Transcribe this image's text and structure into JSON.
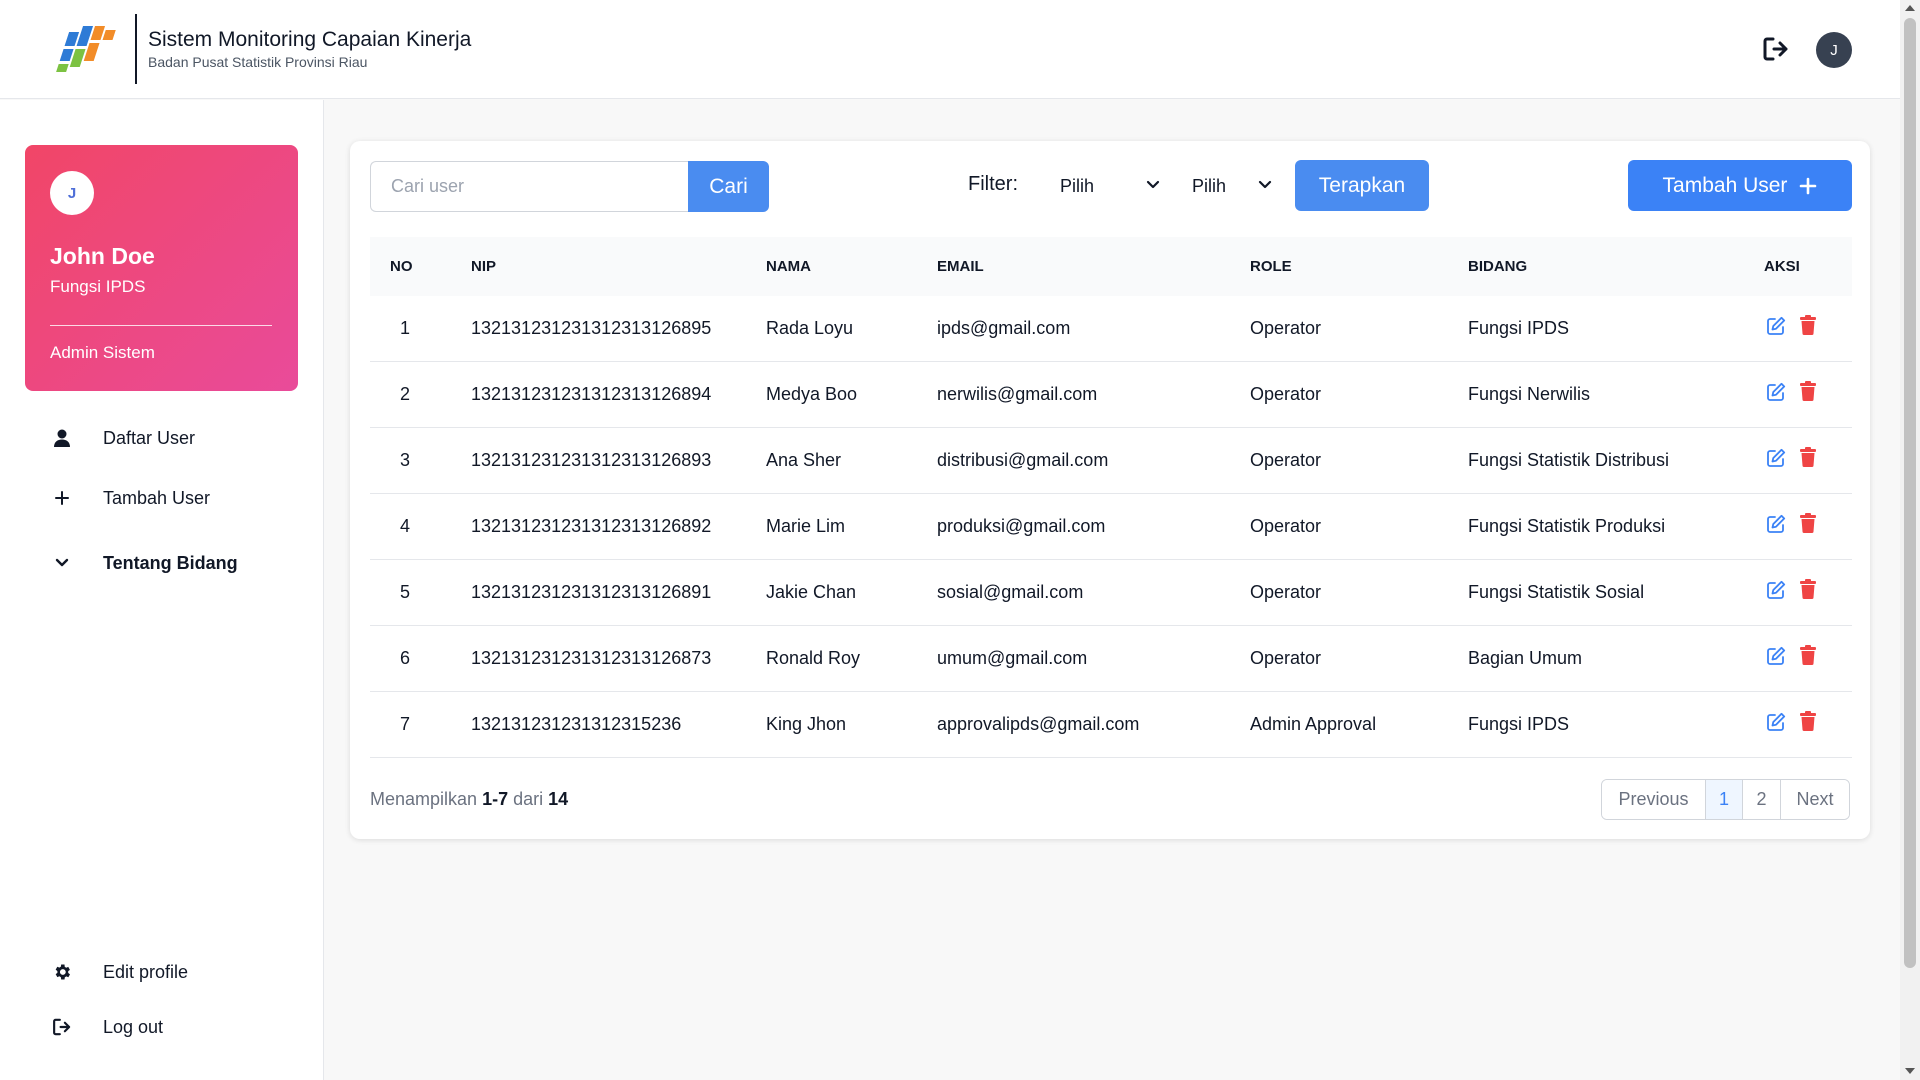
{
  "header": {
    "title": "Sistem Monitoring Capaian Kinerja",
    "subtitle": "Badan Pusat Statistik Provinsi Riau",
    "avatar_initial": "J"
  },
  "sidebar": {
    "profile": {
      "avatar_initial": "J",
      "name": "John Doe",
      "department": "Fungsi IPDS",
      "role": "Admin Sistem"
    },
    "nav": [
      {
        "label": "Daftar User",
        "icon": "user-icon"
      },
      {
        "label": "Tambah User",
        "icon": "plus-icon"
      },
      {
        "label": "Tentang Bidang",
        "icon": "chevron-down-icon"
      }
    ],
    "bottom": [
      {
        "label": "Edit profile",
        "icon": "gear-icon"
      },
      {
        "label": "Log out",
        "icon": "logout-icon"
      }
    ]
  },
  "toolbar": {
    "search_placeholder": "Cari user",
    "search_label": "Cari",
    "filter_label": "Filter:",
    "filter1_value": "Pilih",
    "filter2_value": "Pilih",
    "apply_label": "Terapkan",
    "add_label": "Tambah User"
  },
  "table": {
    "headers": {
      "no": "NO",
      "nip": "NIP",
      "nama": "NAMA",
      "email": "EMAIL",
      "role": "ROLE",
      "bidang": "BIDANG",
      "aksi": "AKSI"
    },
    "rows": [
      {
        "no": "1",
        "nip": "13213123123131231312689‌5",
        "nama": "Rada Loyu",
        "email": "ipds@gmail.com",
        "role": "Operator",
        "bidang": "Fungsi IPDS"
      },
      {
        "no": "2",
        "nip": "132131231231312313126894",
        "nama": "Medya Boo",
        "email": "nerwilis@gmail.com",
        "role": "Operator",
        "bidang": "Fungsi Nerwilis"
      },
      {
        "no": "3",
        "nip": "132131231231312313126893",
        "nama": "Ana Sher",
        "email": "distribusi@gmail.com",
        "role": "Operator",
        "bidang": "Fungsi Statistik Distribusi"
      },
      {
        "no": "4",
        "nip": "132131231231312313126892",
        "nama": "Marie Lim",
        "email": "produksi@gmail.com",
        "role": "Operator",
        "bidang": "Fungsi Statistik Produksi"
      },
      {
        "no": "5",
        "nip": "132131231231312313126891",
        "nama": "Jakie Chan",
        "email": "sosial@gmail.com",
        "role": "Operator",
        "bidang": "Fungsi Statistik Sosial"
      },
      {
        "no": "6",
        "nip": "132131231231312313126873",
        "nama": "Ronald Roy",
        "email": "umum@gmail.com",
        "role": "Operator",
        "bidang": "Bagian Umum"
      },
      {
        "no": "7",
        "nip": "13213123123131231523‌6",
        "nama": "King Jhon",
        "email": "approvalipds@gmail.com",
        "role": "Admin Approval",
        "bidang": "Fungsi IPDS"
      }
    ]
  },
  "footer": {
    "showing_prefix": "Menampilkan",
    "showing_range": "1-7",
    "showing_mid": "dari",
    "showing_total": "14",
    "prev_label": "Previous",
    "pages": [
      "1",
      "2"
    ],
    "next_label": "Next"
  },
  "colors": {
    "primary": "#4a8cf0",
    "card_gradient_start": "#f14667",
    "card_gradient_end": "#e94b9a",
    "delete": "#ef4444"
  }
}
